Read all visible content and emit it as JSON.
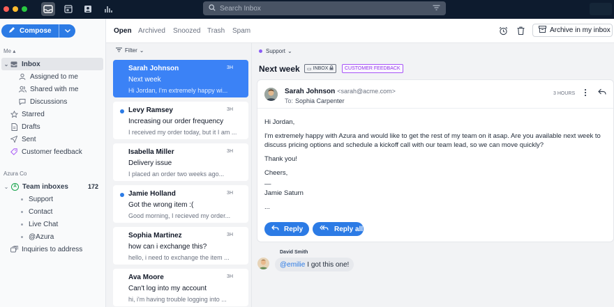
{
  "colors": {
    "accent": "#2c7be5",
    "titlebar": "#0d1b2e",
    "selected_card": "#3b82f6",
    "tag_purple": "#9333ea"
  },
  "search": {
    "placeholder": "Search Inbox"
  },
  "sidebar": {
    "compose_label": "Compose",
    "me_label": "Me",
    "items": [
      {
        "label": "Inbox",
        "icon": "inbox-icon"
      },
      {
        "label": "Assigned to me",
        "icon": "user-icon"
      },
      {
        "label": "Shared with me",
        "icon": "users-icon"
      },
      {
        "label": "Discussions",
        "icon": "chat-icon"
      },
      {
        "label": "Starred",
        "icon": "star-icon"
      },
      {
        "label": "Drafts",
        "icon": "draft-icon"
      },
      {
        "label": "Sent",
        "icon": "send-icon"
      },
      {
        "label": "Customer feedback",
        "icon": "tag-icon"
      }
    ],
    "org_label": "Azura Co",
    "team_inboxes": {
      "label": "Team inboxes",
      "count": "172",
      "badge": "A"
    },
    "team_items": [
      "Support",
      "Contact",
      "Live Chat",
      "@Azura"
    ],
    "inquiries": "Inquiries to address"
  },
  "tabs": [
    "Open",
    "Archived",
    "Snoozed",
    "Trash",
    "Spam"
  ],
  "archive_label": "Archive in my inbox",
  "filter_label": "Filter",
  "conversations": [
    {
      "name": "Sarah Johnson",
      "time": "3H",
      "subject": "Next week",
      "preview": "Hi Jordan, I'm extremely happy wi...",
      "unread": false
    },
    {
      "name": "Levy Ramsey",
      "time": "3H",
      "subject": "Increasing our order frequency",
      "preview": "I received my order today, but it I am ...",
      "unread": true
    },
    {
      "name": "Isabella Miller",
      "time": "3H",
      "subject": "Delivery issue",
      "preview": "I placed an order two weeks ago...",
      "unread": false
    },
    {
      "name": "Jamie Holland",
      "time": "3H",
      "subject": "Got the wrong item :(",
      "preview": "Good morning, I recieved my order...",
      "unread": true
    },
    {
      "name": "Sophia Martinez",
      "time": "3H",
      "subject": "how can i exchange this?",
      "preview": "hello, i need to exchange the item ...",
      "unread": false
    },
    {
      "name": "Ava Moore",
      "time": "3H",
      "subject": "Can't log into my account",
      "preview": "hi, i'm having trouble logging into ...",
      "unread": false
    }
  ],
  "pane": {
    "inbox_name": "Support",
    "title": "Next week",
    "tag_inbox": "INBOX",
    "tag_feedback": "CUSTOMER FEEDBACK",
    "message": {
      "from_name": "Sarah Johnson",
      "from_email": "<sarah@acme.com>",
      "to_label": "To:",
      "to_name": "Sophia Carpenter",
      "time": "3 HOURS",
      "greeting": "Hi Jordan,",
      "body": "I'm extremely happy with Azura and would like to get the rest of my team on it asap. Are you available next week to discuss pricing options and schedule a kickoff call with our team lead, so we can move quickly?",
      "thanks": "Thank you!",
      "closing": "Cheers,",
      "dash": "—",
      "signature": "Jamie Saturn",
      "ellipsis": "..."
    },
    "reply_label": "Reply",
    "reply_all_label": "Reply all",
    "comment": {
      "author": "David Smith",
      "mention": "@emilie",
      "text": "I got this one!"
    }
  }
}
